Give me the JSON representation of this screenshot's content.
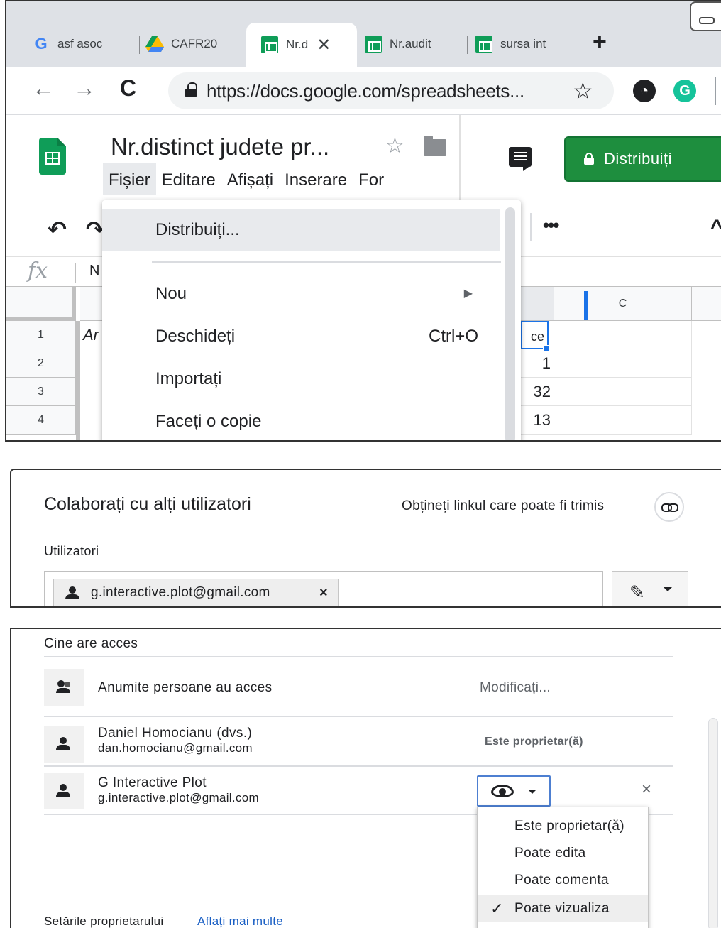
{
  "browser": {
    "tabs": [
      {
        "icon": "google-icon",
        "label": "asf asoc"
      },
      {
        "icon": "drive-icon",
        "label": "CAFR20"
      },
      {
        "icon": "sheets-icon",
        "label": "Nr.d",
        "close": "✕"
      },
      {
        "icon": "sheets-icon",
        "label": "Nr.audit"
      },
      {
        "icon": "sheets-icon",
        "label": "sursa int"
      }
    ],
    "new_tab": "+",
    "url": "https://docs.google.com/spreadsheets..."
  },
  "doc": {
    "title": "Nr.distinct judete pr...",
    "menu": [
      "Fișier",
      "Editare",
      "Afișați",
      "Inserare",
      "For"
    ],
    "share_label": "Distribuiți",
    "formula_value": "N"
  },
  "grid": {
    "col_c": "C",
    "rows": [
      "1",
      "2",
      "3",
      "4"
    ],
    "a1": "Ar",
    "b_values": [
      "ce",
      "1",
      "32",
      "13"
    ]
  },
  "file_menu": {
    "items": [
      {
        "label": "Distribuiți..."
      },
      {
        "label": "Nou"
      },
      {
        "label": "Deschideți",
        "shortcut": "Ctrl+O"
      },
      {
        "label": "Importați"
      },
      {
        "label": "Faceți o copie"
      }
    ]
  },
  "share_dialog": {
    "title": "Colaborați cu alți utilizatori",
    "get_link": "Obțineți linkul care poate fi trimis",
    "users_label": "Utilizatori",
    "chip_email": "g.interactive.plot@gmail.com",
    "chip_remove": "×"
  },
  "access": {
    "heading": "Cine are acces",
    "restriction": "Anumite persoane au acces",
    "change": "Modificați...",
    "people": [
      {
        "name": "Daniel Homocianu (dvs.)",
        "email": "dan.homocianu@gmail.com",
        "role": "Este proprietar(ă)"
      },
      {
        "name": "G Interactive Plot",
        "email": "g.interactive.plot@gmail.com",
        "role": "Poate vizualiza"
      }
    ],
    "remove": "×",
    "role_options": [
      "Este proprietar(ă)",
      "Poate edita",
      "Poate comenta",
      "Poate vizualiza"
    ],
    "selected_role": "Poate vizualiza",
    "owner_settings": "Setările proprietarului",
    "learn_more": "Aflați mai multe"
  }
}
